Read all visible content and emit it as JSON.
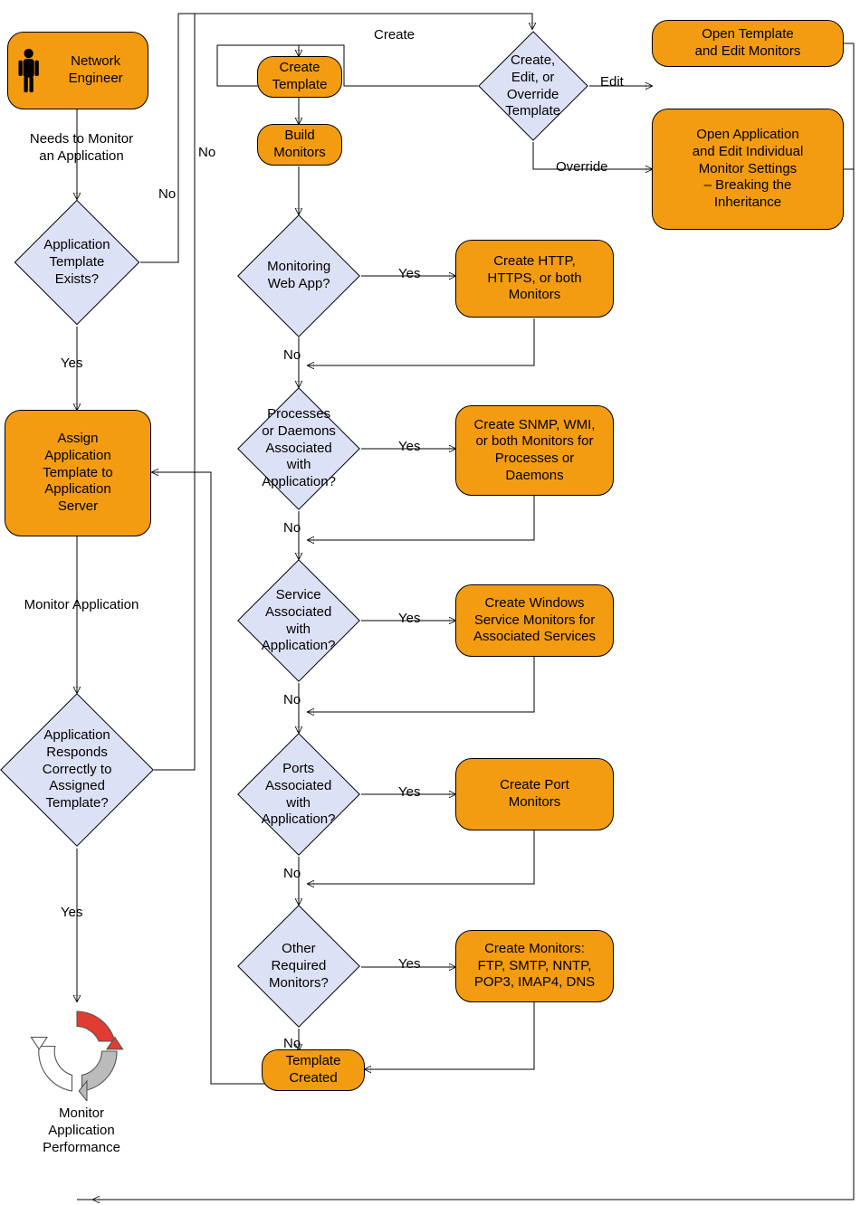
{
  "actor": {
    "title": "Network Engineer"
  },
  "labels": {
    "needs_monitor": "Needs to Monitor\nan Application",
    "monitor_app": "Monitor Application",
    "monitor_perf": "Monitor\nApplication\nPerformance",
    "yes": "Yes",
    "no": "No",
    "create": "Create",
    "edit": "Edit",
    "override": "Override"
  },
  "decisions": {
    "template_exists": "Application\nTemplate\nExists?",
    "responds_correct": "Application\nResponds\nCorrectly to\nAssigned\nTemplate?",
    "monitoring_web": "Monitoring\nWeb App?",
    "processes": "Processes\nor Daemons\nAssociated with\nApplication?",
    "service": "Service\nAssociated with\nApplication?",
    "ports": "Ports\nAssociated with\nApplication?",
    "other_monitors": "Other Required\nMonitors?",
    "create_edit_override": "Create,\nEdit, or\nOverride\nTemplate"
  },
  "processes": {
    "assign_template": "Assign\nApplication\nTemplate to\nApplication\nServer",
    "create_template": "Create\nTemplate",
    "build_monitors": "Build\nMonitors",
    "create_http": "Create HTTP,\nHTTPS, or both\nMonitors",
    "create_snmp": "Create SNMP, WMI,\nor both Monitors for\nProcesses or\nDaemons",
    "create_win_svc": "Create Windows\nService Monitors for\nAssociated Services",
    "create_port": "Create Port\nMonitors",
    "create_other": "Create Monitors:\nFTP, SMTP, NNTP,\nPOP3, IMAP4, DNS",
    "template_created": "Template\nCreated",
    "open_template_edit": "Open Template\nand Edit Monitors",
    "open_app_edit": "Open Application\nand Edit Individual\nMonitor Settings\n– Breaking the\nInheritance"
  },
  "colors": {
    "process": "#F39C12",
    "decision": "#DDE1F5"
  }
}
